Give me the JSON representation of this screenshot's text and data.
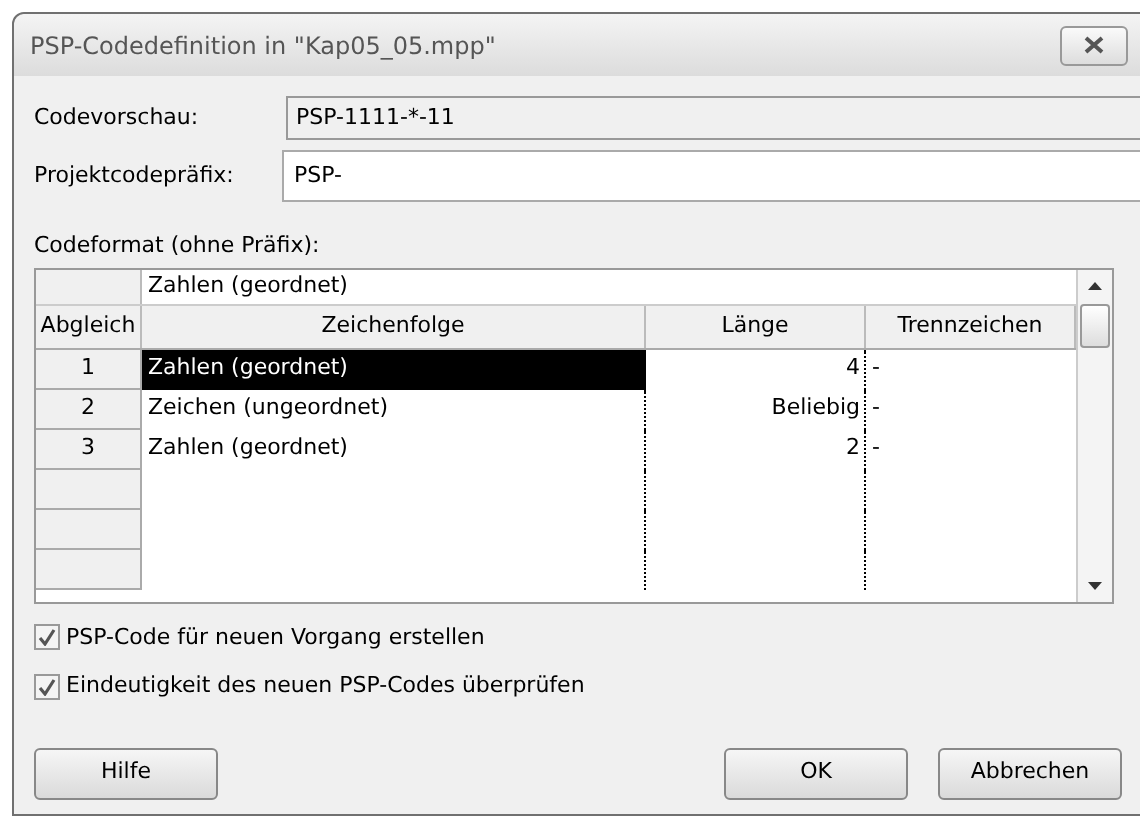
{
  "window": {
    "title": "PSP-Codedefinition in \"Kap05_05.mpp\""
  },
  "preview": {
    "label": "Codevorschau:",
    "value": "PSP-1111-*-11"
  },
  "prefix": {
    "label": "Projektcodepräfix:",
    "value": "PSP-"
  },
  "format": {
    "label": "Codeformat (ohne Präfix):",
    "edit_value": "Zahlen (geordnet)",
    "columns": [
      "Abgleich",
      "Zeichenfolge",
      "Länge",
      "Trennzeichen"
    ],
    "rows": [
      {
        "index": "1",
        "sequence": "Zahlen (geordnet)",
        "length": "4",
        "separator": "-",
        "selected": true
      },
      {
        "index": "2",
        "sequence": "Zeichen (ungeordnet)",
        "length": "Beliebig",
        "separator": "-",
        "selected": false
      },
      {
        "index": "3",
        "sequence": "Zahlen (geordnet)",
        "length": "2",
        "separator": "-",
        "selected": false
      }
    ]
  },
  "options": [
    {
      "label": "PSP-Code für neuen Vorgang erstellen",
      "checked": true
    },
    {
      "label": "Eindeutigkeit des neuen PSP-Codes überprüfen",
      "checked": true
    }
  ],
  "buttons": [
    {
      "label": "Hilfe",
      "kind": "left"
    },
    {
      "label": "OK",
      "kind": "default"
    },
    {
      "label": "Abbrechen",
      "kind": "normal"
    }
  ]
}
